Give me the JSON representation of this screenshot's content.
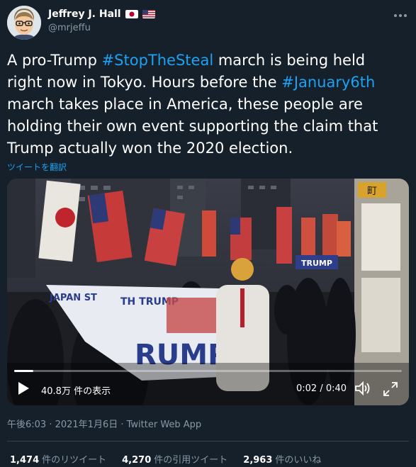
{
  "author": {
    "display_name": "Jeffrey J. Hall",
    "handle": "@mrjeffu",
    "flags": [
      "japan-flag",
      "us-flag"
    ],
    "more_icon": "ellipsis-icon"
  },
  "tweet": {
    "segments": [
      {
        "text": "A pro-Trump ",
        "type": "text"
      },
      {
        "text": "#StopTheSteal",
        "type": "hashtag"
      },
      {
        "text": " march is being held right now in Tokyo. Hours before the ",
        "type": "text"
      },
      {
        "text": "#January6th",
        "type": "hashtag"
      },
      {
        "text": " march takes place in America, these people are holding their own event supporting the claim that Trump actually won the 2020 election.",
        "type": "text"
      }
    ],
    "translate_label": "ツイートを翻訳"
  },
  "video": {
    "views_label": "40.8万 件の表示",
    "time_label": "0:02 / 0:40",
    "progress": 0.05,
    "scene_text": {
      "station_sign_top": "町",
      "banner_left": "JAPAN ST",
      "banner_right": "TH TRUMP",
      "banner_big": "RUMP",
      "sign_small": "TRUMP"
    }
  },
  "meta": {
    "timestamp": "午後6:03 · 2021年1月6日 · Twitter Web App"
  },
  "stats": [
    {
      "value": "1,474",
      "label": "件のリツイート"
    },
    {
      "value": "4,270",
      "label": "件の引用ツイート"
    },
    {
      "value": "2,963",
      "label": "件のいいね"
    }
  ],
  "colors": {
    "background": "#15202b",
    "link": "#1da1f2",
    "muted": "#8899a6",
    "divider": "#38444d"
  }
}
